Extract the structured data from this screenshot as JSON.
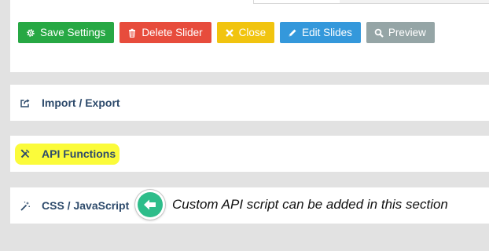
{
  "toolbar": {
    "buttons": [
      {
        "label": "Save Settings",
        "icon": "gear-icon",
        "color": "#27a844"
      },
      {
        "label": "Delete Slider",
        "icon": "trash-icon",
        "color": "#e74c3c"
      },
      {
        "label": "Close",
        "icon": "close-icon",
        "color": "#f1c40f"
      },
      {
        "label": "Edit Slides",
        "icon": "pencil-icon",
        "color": "#3498db"
      },
      {
        "label": "Preview",
        "icon": "search-icon",
        "color": "#95a5a6"
      }
    ]
  },
  "sections": [
    {
      "label": "Import / Export",
      "icon": "share-export-icon"
    },
    {
      "label": "API Functions",
      "icon": "tools-icon",
      "highlighted": true,
      "highlight_color": "#fbfb3a"
    },
    {
      "label": "CSS / JavaScript",
      "icon": "magic-wand-icon"
    }
  ],
  "annotation": {
    "text": "Custom API script can be added in this section",
    "icon": "arrow-left-icon",
    "color": "#2ebd8a"
  }
}
